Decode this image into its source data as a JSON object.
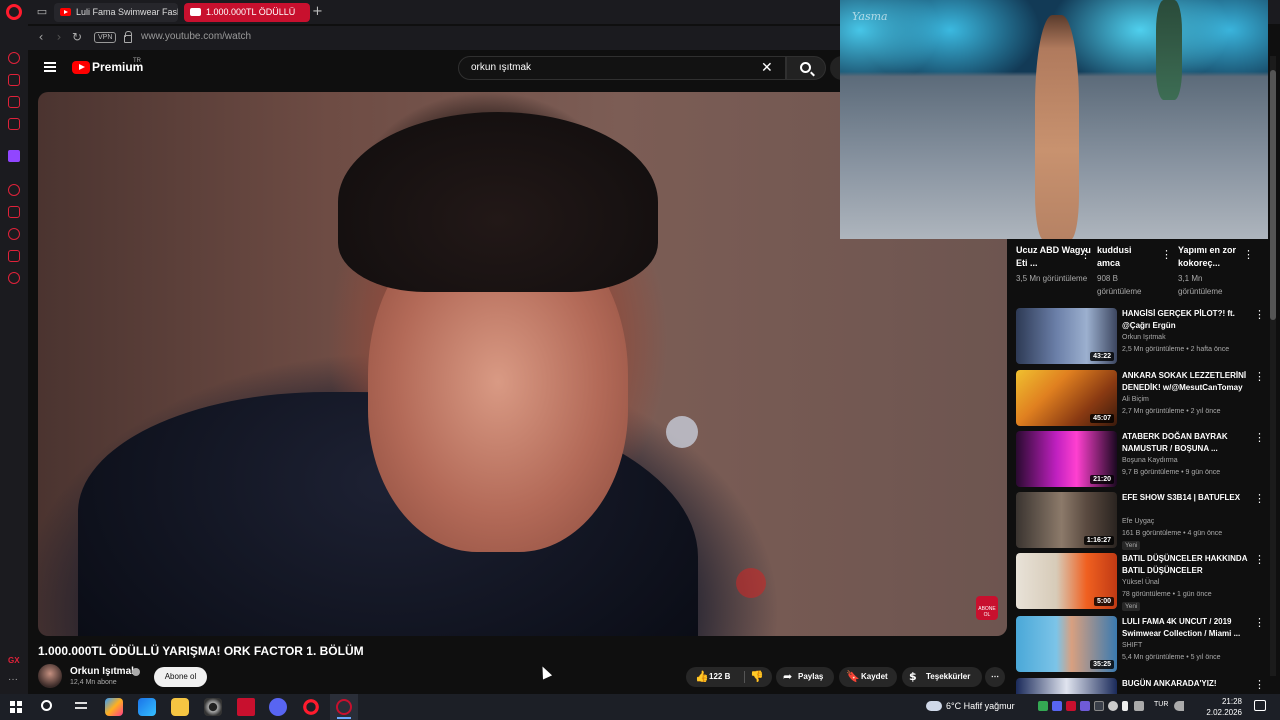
{
  "browser": {
    "tabs": [
      {
        "label": "Luli Fama Swimwear Fashi"
      },
      {
        "label": "1.000.000TL ÖDÜLLÜ"
      }
    ],
    "new_tab": "+",
    "vpn_label": "VPN",
    "url": "www.youtube.com/watch"
  },
  "youtube": {
    "brand": "Premium",
    "country": "TR",
    "search_value": "orkun ışıtmak",
    "video": {
      "title": "1.000.000TL ÖDÜLLÜ YARIŞMA! ORK FACTOR 1. BÖLÜM",
      "channel": "Orkun Işıtmak",
      "subscribers": "12,4 Mn abone",
      "subscribe_label": "Abone ol",
      "likes": "122 B",
      "share_label": "Paylaş",
      "save_label": "Kaydet",
      "thanks_label": "Teşekkürler",
      "overlay_badge": "ABONE OL"
    }
  },
  "pip": {
    "watermark": "Yasma"
  },
  "shorts": [
    {
      "title": "Ucuz ABD Wagyu Eti ...",
      "views": "3,5 Mn görüntüleme"
    },
    {
      "title": "kuddusi amca",
      "views": "908 B görüntüleme"
    },
    {
      "title": "Yapımı en zor kokoreç...",
      "views": "3,1 Mn görüntüleme"
    }
  ],
  "recommendations": [
    {
      "title": "HANGİSİ GERÇEK PİLOT?! ft. @Çağrı Ergün",
      "channel": "Orkun Işıtmak",
      "meta": "2,5 Mn görüntüleme • 2 hafta önce",
      "duration": "43:22",
      "badge": ""
    },
    {
      "title": "ANKARA SOKAK LEZZETLERİNİ DENEDİK! w/@MesutCanTomay",
      "channel": "Ali Biçim",
      "meta": "2,7 Mn görüntüleme • 2 yıl önce",
      "duration": "45:07",
      "badge": ""
    },
    {
      "title": "ATABERK DOĞAN BAYRAK NAMUSTUR / BOŞUNA ...",
      "channel": "Boşuna Kaydırma",
      "meta": "9,7 B görüntüleme • 9 gün önce",
      "duration": "21:20",
      "badge": ""
    },
    {
      "title": "EFE SHOW S3B14 | BATUFLEX",
      "channel": "Efe Uygaç",
      "meta": "161 B görüntüleme • 4 gün önce",
      "duration": "1:16:27",
      "badge": "Yeni"
    },
    {
      "title": "BATIL DÜŞÜNCELER HAKKINDA BATIL DÜŞÜNCELER",
      "channel": "Yüksel Ünal",
      "meta": "78 görüntüleme • 1 gün önce",
      "duration": "5:00",
      "badge": "Yeni"
    },
    {
      "title": "LULI FAMA 4K UNCUT / 2019 Swimwear Collection / Miami ...",
      "channel": "SHIFT",
      "meta": "5,4 Mn görüntüleme • 5 yıl önce",
      "duration": "35:25",
      "badge": ""
    },
    {
      "title": "BUGÜN ANKARADA'YIZ!",
      "channel": "",
      "meta": "",
      "duration": "",
      "badge": ""
    }
  ],
  "taskbar": {
    "weather": "6°C  Hafif yağmur",
    "language": "TUR",
    "time": "21:28",
    "date": "2.02.2026"
  }
}
